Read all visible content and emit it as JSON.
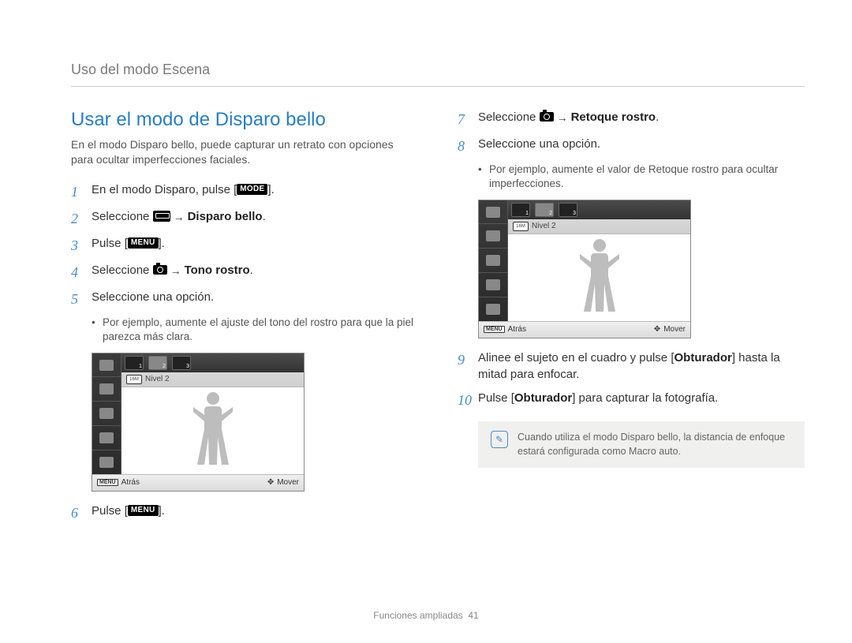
{
  "breadcrumb": "Uso del modo Escena",
  "section_title": "Usar el modo de Disparo bello",
  "intro": "En el modo Disparo bello, puede capturar un retrato con opciones para ocultar imperfecciones faciales.",
  "steps": {
    "s1": {
      "num": "1",
      "pre": "En el modo Disparo, pulse [",
      "label": "MODE",
      "post": "]."
    },
    "s2": {
      "num": "2",
      "pre": "Seleccione ",
      "bold": "Disparo bello",
      "post": "."
    },
    "s3": {
      "num": "3",
      "pre": "Pulse [",
      "label": "MENU",
      "post": "]."
    },
    "s4": {
      "num": "4",
      "pre": "Seleccione ",
      "bold": "Tono rostro",
      "post": "."
    },
    "s5": {
      "num": "5",
      "text": "Seleccione una opción."
    },
    "s5_sub": "Por ejemplo, aumente el ajuste del tono del rostro para que la piel parezca más clara.",
    "s6": {
      "num": "6",
      "pre": "Pulse [",
      "label": "MENU",
      "post": "]."
    },
    "s7": {
      "num": "7",
      "pre": "Seleccione ",
      "bold": "Retoque rostro",
      "post": "."
    },
    "s8": {
      "num": "8",
      "text": "Seleccione una opción."
    },
    "s8_sub": "Por ejemplo, aumente el valor de Retoque rostro para ocultar imperfecciones.",
    "s9": {
      "num": "9",
      "pre": "Alinee el sujeto en el cuadro y pulse [",
      "bold": "Obturador",
      "post": "] hasta la mitad para enfocar."
    },
    "s10": {
      "num": "10",
      "pre": "Pulse [",
      "bold": "Obturador",
      "post": "] para capturar la fotografía."
    }
  },
  "screen": {
    "level_label": "Nivel 2",
    "size_label": "16M",
    "footer_back": "Atrás",
    "footer_move": "Mover",
    "top_numbers": [
      "1",
      "2",
      "3"
    ]
  },
  "note": "Cuando utiliza el modo Disparo bello, la distancia de enfoque estará configurada como Macro auto.",
  "footer": {
    "section": "Funciones ampliadas",
    "page": "41"
  }
}
